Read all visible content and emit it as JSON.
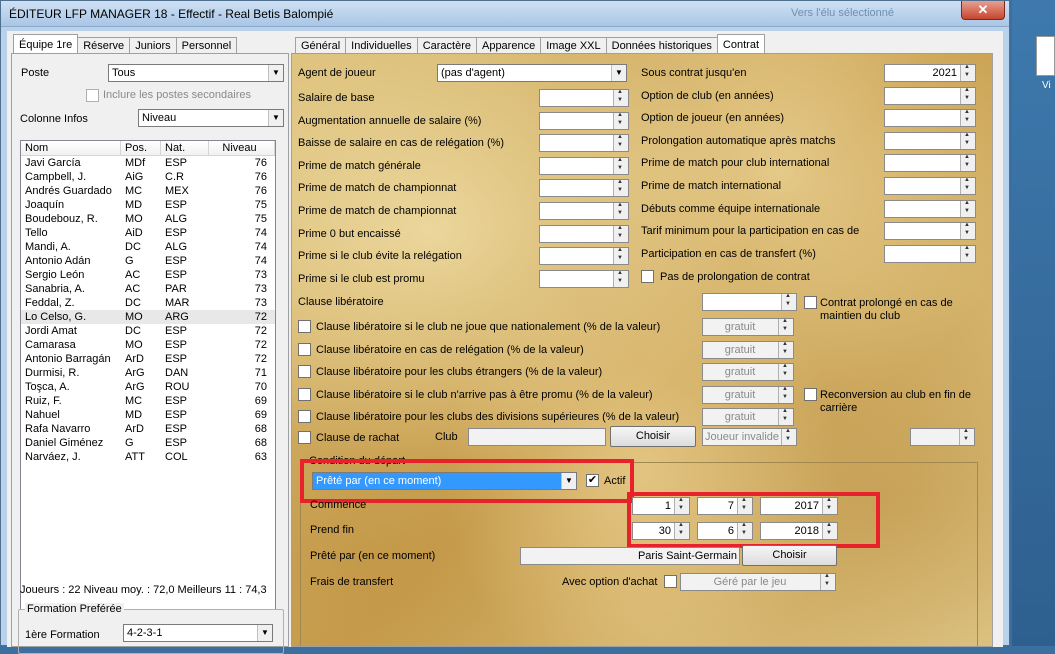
{
  "window": {
    "title": "ÉDITEUR LFP MANAGER 18 - Effectif - Real Betis Balompié",
    "ghost_text": "Vers l'élu sélectionné"
  },
  "desktop": {
    "icon_label": "Vi"
  },
  "left_tabs": [
    "Équipe 1re",
    "Réserve",
    "Juniors",
    "Personnel"
  ],
  "left": {
    "poste_label": "Poste",
    "poste_value": "Tous",
    "secondary_label": "Inclure les postes secondaires",
    "col_info_label": "Colonne Infos",
    "col_info_value": "Niveau",
    "headers": [
      "Nom",
      "Pos.",
      "Nat.",
      "Niveau"
    ],
    "players": [
      [
        "Javi García",
        "MDf",
        "ESP",
        "76"
      ],
      [
        "Campbell, J.",
        "AiG",
        "C.R",
        "76"
      ],
      [
        "Andrés Guardado",
        "MC",
        "MEX",
        "76"
      ],
      [
        "Joaquín",
        "MD",
        "ESP",
        "75"
      ],
      [
        "Boudebouz, R.",
        "MO",
        "ALG",
        "75"
      ],
      [
        "Tello",
        "AiD",
        "ESP",
        "74"
      ],
      [
        "Mandi, A.",
        "DC",
        "ALG",
        "74"
      ],
      [
        "Antonio Adán",
        "G",
        "ESP",
        "74"
      ],
      [
        "Sergio León",
        "AC",
        "ESP",
        "73"
      ],
      [
        "Sanabria, A.",
        "AC",
        "PAR",
        "73"
      ],
      [
        "Feddal, Z.",
        "DC",
        "MAR",
        "73"
      ],
      [
        "Lo Celso, G.",
        "MO",
        "ARG",
        "72"
      ],
      [
        "Jordi Amat",
        "DC",
        "ESP",
        "72"
      ],
      [
        "Camarasa",
        "MO",
        "ESP",
        "72"
      ],
      [
        "Antonio Barragán",
        "ArD",
        "ESP",
        "72"
      ],
      [
        "Durmisi, R.",
        "ArG",
        "DAN",
        "71"
      ],
      [
        "Toşca, A.",
        "ArG",
        "ROU",
        "70"
      ],
      [
        "Ruiz, F.",
        "MC",
        "ESP",
        "69"
      ],
      [
        "Nahuel",
        "MD",
        "ESP",
        "69"
      ],
      [
        "Rafa Navarro",
        "ArD",
        "ESP",
        "68"
      ],
      [
        "Daniel Giménez",
        "G",
        "ESP",
        "68"
      ],
      [
        "Narváez, J.",
        "ATT",
        "COL",
        "63"
      ]
    ],
    "stats": "Joueurs : 22   Niveau moy. : 72,0   Meilleurs 11 : 74,3",
    "formation_group": "Formation Preférée",
    "formation_label": "1ère Formation",
    "formation_value": "4-2-3-1"
  },
  "right_tabs": [
    "Général",
    "Individuelles",
    "Caractère",
    "Apparence",
    "Image XXL",
    "Données historiques",
    "Contrat"
  ],
  "contract": {
    "agent_label": "Agent de joueur",
    "agent_value": "(pas d'agent)",
    "left_fields": [
      "Salaire de base",
      "Augmentation annuelle de salaire (%)",
      "Baisse de salaire en cas de relégation (%)",
      "Prime de match générale",
      "Prime de match de championnat",
      "Prime de match de championnat",
      "Prime 0 but encaissé",
      "Prime si le club évite la relégation",
      "Prime si le club est promu"
    ],
    "right_fields": [
      {
        "label": "Sous contrat jusqu'en",
        "value": "2021"
      },
      {
        "label": "Option de club (en années)",
        "value": ""
      },
      {
        "label": "Option de joueur (en années)",
        "value": ""
      },
      {
        "label": "Prolongation automatique après matchs",
        "value": ""
      },
      {
        "label": "Prime de match pour club international",
        "value": ""
      },
      {
        "label": "Prime de match international",
        "value": ""
      },
      {
        "label": "Débuts comme équipe internationale",
        "value": ""
      },
      {
        "label": "Tarif minimum pour la participation en cas de",
        "value": ""
      },
      {
        "label": "Participation en cas de transfert (%)",
        "value": ""
      }
    ],
    "no_extension_label": "Pas de prolongation de contrat",
    "release_label": "Clause libératoire",
    "extended_label": "Contrat prolongé en cas de maintien du club",
    "clauses": [
      "Clause libératoire si le club ne joue que nationalement (% de la valeur)",
      "Clause libératoire en cas de relégation (% de la valeur)",
      "Clause libératoire pour les clubs étrangers (% de la valeur)",
      "Clause libératoire si le club n'arrive pas à être promu  (% de la valeur)",
      "Clause libératoire pour les clubs des divisions supérieures (% de la valeur)"
    ],
    "free_value": "gratuit",
    "reconversion_label": "Reconversion au club en fin de carrière",
    "rachat_label": "Clause de rachat",
    "club_label": "Club",
    "choose_label": "Choisir",
    "invalid_player": "Joueur invalide",
    "depart_group": "Condition du départ",
    "depart_value": "Prêté par (en ce moment)",
    "active_label": "Actif",
    "start_label": "Commence",
    "start": {
      "day": "1",
      "month": "7",
      "year": "2017"
    },
    "end_label": "Prend fin",
    "end": {
      "day": "30",
      "month": "6",
      "year": "2018"
    },
    "loaned_label": "Prêté par (en ce moment)",
    "loan_club": "Paris Saint-Germain",
    "fee_label": "Frais de transfert",
    "buy_option_label": "Avec option d'achat",
    "managed_by": "Géré par le jeu"
  }
}
